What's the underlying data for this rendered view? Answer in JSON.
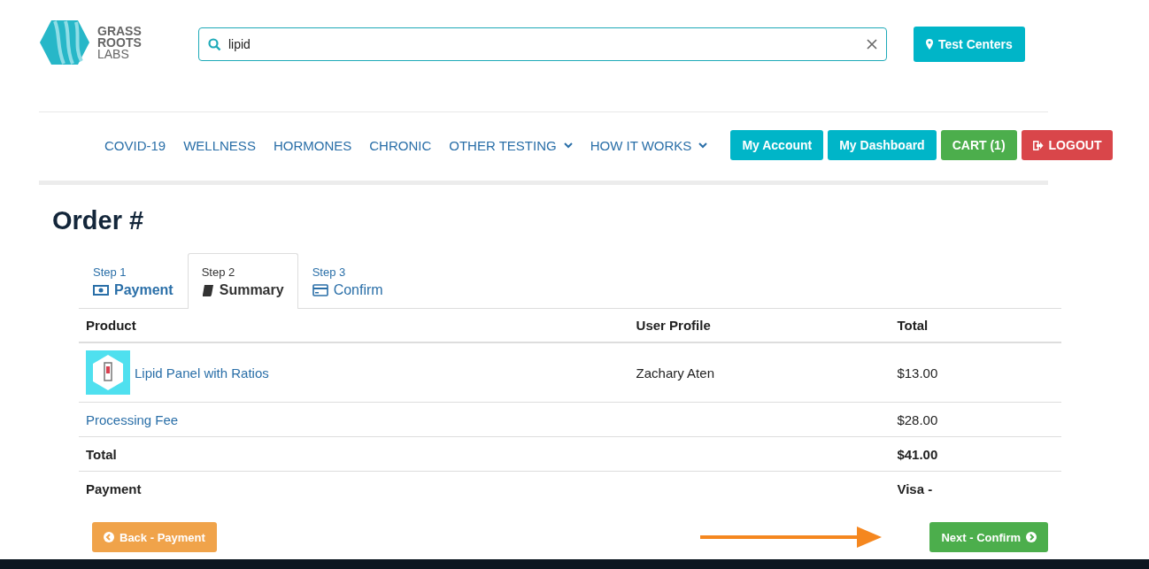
{
  "header": {
    "logo": {
      "line_1": "GRASS",
      "line_2": "ROOTS",
      "line_3": "LABS"
    },
    "search": {
      "value": "lipid"
    },
    "test_centers_button": "Test Centers"
  },
  "nav": {
    "items": [
      {
        "label": "COVID-19",
        "dropdown": false
      },
      {
        "label": "WELLNESS",
        "dropdown": false
      },
      {
        "label": "HORMONES",
        "dropdown": false
      },
      {
        "label": "CHRONIC",
        "dropdown": false
      },
      {
        "label": "OTHER TESTING",
        "dropdown": true
      },
      {
        "label": "HOW IT WORKS",
        "dropdown": true
      }
    ],
    "buttons": [
      {
        "label": "My Account",
        "kind": "info"
      },
      {
        "label": "My Dashboard",
        "kind": "info"
      },
      {
        "label": "CART (1)",
        "kind": "success"
      },
      {
        "label": "LOGOUT",
        "kind": "danger"
      }
    ]
  },
  "page_title": "Order #",
  "tabs": [
    {
      "step": "Step 1",
      "label": "Payment",
      "selected": false
    },
    {
      "step": "Step 2",
      "label": "Summary",
      "selected": true
    },
    {
      "step": "Step 3",
      "label": "Confirm",
      "selected": false
    }
  ],
  "table": {
    "columns": [
      "Product",
      "User Profile",
      "Total"
    ],
    "rows": [
      {
        "kind": "product",
        "product": "Lipid Panel with Ratios",
        "user_profile": "Zachary Aten",
        "total": "$13.00"
      },
      {
        "kind": "fee",
        "product": "Processing Fee",
        "total": "$28.00"
      },
      {
        "kind": "summary",
        "product": "Total",
        "total": "$41.00"
      },
      {
        "kind": "summary",
        "product": "Payment",
        "total": "Visa -"
      }
    ]
  },
  "back_button": "Back - Payment",
  "next_button": "Next - Confirm"
}
